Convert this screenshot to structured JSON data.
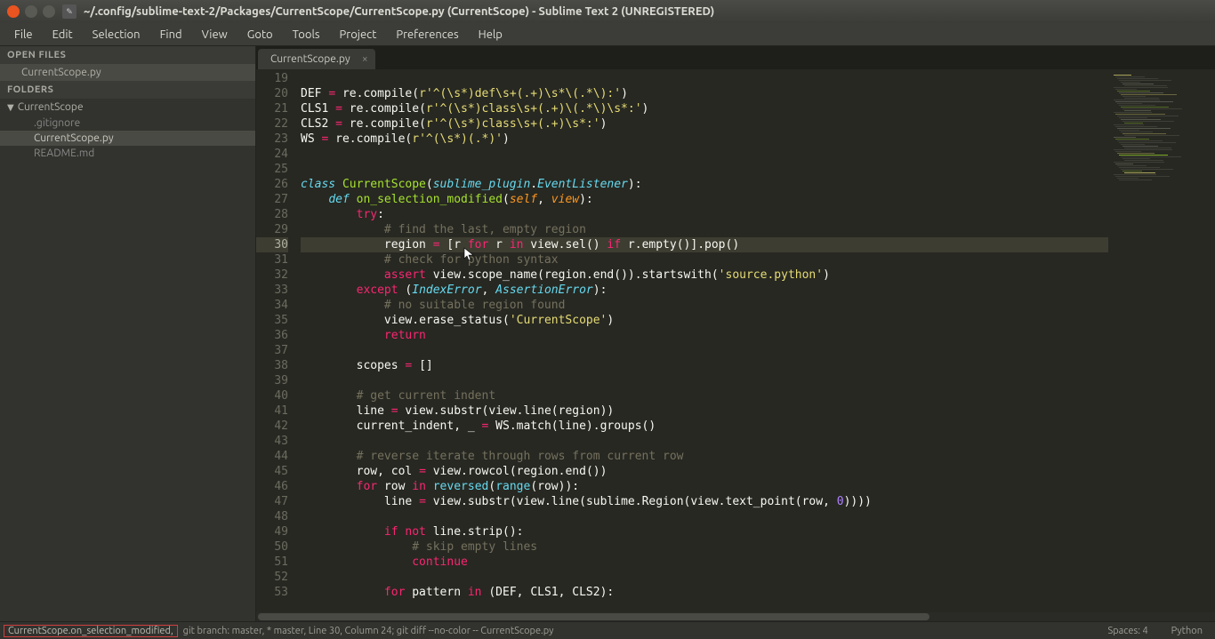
{
  "window": {
    "title": "~/.config/sublime-text-2/Packages/CurrentScope/CurrentScope.py (CurrentScope) - Sublime Text 2 (UNREGISTERED)"
  },
  "menu": [
    "File",
    "Edit",
    "Selection",
    "Find",
    "View",
    "Goto",
    "Tools",
    "Project",
    "Preferences",
    "Help"
  ],
  "open_files_header": "OPEN FILES",
  "open_files": [
    "CurrentScope.py"
  ],
  "folders_header": "FOLDERS",
  "folder_root": "CurrentScope",
  "folder_files": [
    {
      "name": ".gitignore",
      "sel": false
    },
    {
      "name": "CurrentScope.py",
      "sel": true
    },
    {
      "name": "README.md",
      "sel": false
    }
  ],
  "tab_name": "CurrentScope.py",
  "line_start": 19,
  "highlight_line": 30,
  "code_lines": [
    [],
    [
      {
        "c": "var",
        "t": "DEF "
      },
      {
        "c": "op",
        "t": "="
      },
      {
        "c": "var",
        "t": " re"
      },
      {
        "c": "punc",
        "t": "."
      },
      {
        "c": "var",
        "t": "compile"
      },
      {
        "c": "punc",
        "t": "("
      },
      {
        "c": "str",
        "t": "r'^(\\s*)def\\s+(.+)\\s*\\(.*\\):'"
      },
      {
        "c": "punc",
        "t": ")"
      }
    ],
    [
      {
        "c": "var",
        "t": "CLS1 "
      },
      {
        "c": "op",
        "t": "="
      },
      {
        "c": "var",
        "t": " re"
      },
      {
        "c": "punc",
        "t": "."
      },
      {
        "c": "var",
        "t": "compile"
      },
      {
        "c": "punc",
        "t": "("
      },
      {
        "c": "str",
        "t": "r'^(\\s*)class\\s+(.+)\\(.*\\)\\s*:'"
      },
      {
        "c": "punc",
        "t": ")"
      }
    ],
    [
      {
        "c": "var",
        "t": "CLS2 "
      },
      {
        "c": "op",
        "t": "="
      },
      {
        "c": "var",
        "t": " re"
      },
      {
        "c": "punc",
        "t": "."
      },
      {
        "c": "var",
        "t": "compile"
      },
      {
        "c": "punc",
        "t": "("
      },
      {
        "c": "str",
        "t": "r'^(\\s*)class\\s+(.+)\\s*:'"
      },
      {
        "c": "punc",
        "t": ")"
      }
    ],
    [
      {
        "c": "var",
        "t": "WS "
      },
      {
        "c": "op",
        "t": "="
      },
      {
        "c": "var",
        "t": " re"
      },
      {
        "c": "punc",
        "t": "."
      },
      {
        "c": "var",
        "t": "compile"
      },
      {
        "c": "punc",
        "t": "("
      },
      {
        "c": "str",
        "t": "r'^(\\s*)(.*)'"
      },
      {
        "c": "punc",
        "t": ")"
      }
    ],
    [],
    [],
    [
      {
        "c": "def",
        "t": "class "
      },
      {
        "c": "name",
        "t": "CurrentScope"
      },
      {
        "c": "punc",
        "t": "("
      },
      {
        "c": "type",
        "t": "sublime_plugin"
      },
      {
        "c": "punc",
        "t": "."
      },
      {
        "c": "type",
        "t": "EventListener"
      },
      {
        "c": "punc",
        "t": "):"
      }
    ],
    [
      {
        "c": "var",
        "t": "    "
      },
      {
        "c": "def",
        "t": "def "
      },
      {
        "c": "name",
        "t": "on_selection_modified"
      },
      {
        "c": "punc",
        "t": "("
      },
      {
        "c": "param",
        "t": "self"
      },
      {
        "c": "punc",
        "t": ", "
      },
      {
        "c": "param",
        "t": "view"
      },
      {
        "c": "punc",
        "t": "):"
      }
    ],
    [
      {
        "c": "var",
        "t": "        "
      },
      {
        "c": "kw",
        "t": "try"
      },
      {
        "c": "punc",
        "t": ":"
      }
    ],
    [
      {
        "c": "var",
        "t": "            "
      },
      {
        "c": "comment",
        "t": "# find the last, empty region"
      }
    ],
    [
      {
        "c": "var",
        "t": "            region "
      },
      {
        "c": "op",
        "t": "="
      },
      {
        "c": "var",
        "t": " "
      },
      {
        "c": "punc",
        "t": "["
      },
      {
        "c": "var",
        "t": "r "
      },
      {
        "c": "kw",
        "t": "for"
      },
      {
        "c": "var",
        "t": " r "
      },
      {
        "c": "kw",
        "t": "in"
      },
      {
        "c": "var",
        "t": " view"
      },
      {
        "c": "punc",
        "t": "."
      },
      {
        "c": "var",
        "t": "sel"
      },
      {
        "c": "punc",
        "t": "() "
      },
      {
        "c": "kw",
        "t": "if"
      },
      {
        "c": "var",
        "t": " r"
      },
      {
        "c": "punc",
        "t": "."
      },
      {
        "c": "var",
        "t": "empty"
      },
      {
        "c": "punc",
        "t": "()]"
      },
      {
        "c": "punc",
        "t": "."
      },
      {
        "c": "var",
        "t": "pop"
      },
      {
        "c": "punc",
        "t": "()"
      }
    ],
    [
      {
        "c": "var",
        "t": "            "
      },
      {
        "c": "comment",
        "t": "# check for python syntax"
      }
    ],
    [
      {
        "c": "var",
        "t": "            "
      },
      {
        "c": "kw",
        "t": "assert"
      },
      {
        "c": "var",
        "t": " view"
      },
      {
        "c": "punc",
        "t": "."
      },
      {
        "c": "var",
        "t": "scope_name"
      },
      {
        "c": "punc",
        "t": "("
      },
      {
        "c": "var",
        "t": "region"
      },
      {
        "c": "punc",
        "t": "."
      },
      {
        "c": "var",
        "t": "end"
      },
      {
        "c": "punc",
        "t": "())."
      },
      {
        "c": "var",
        "t": "startswith"
      },
      {
        "c": "punc",
        "t": "("
      },
      {
        "c": "str",
        "t": "'source.python'"
      },
      {
        "c": "punc",
        "t": ")"
      }
    ],
    [
      {
        "c": "var",
        "t": "        "
      },
      {
        "c": "kw",
        "t": "except"
      },
      {
        "c": "var",
        "t": " "
      },
      {
        "c": "punc",
        "t": "("
      },
      {
        "c": "type",
        "t": "IndexError"
      },
      {
        "c": "punc",
        "t": ", "
      },
      {
        "c": "type",
        "t": "AssertionError"
      },
      {
        "c": "punc",
        "t": "):"
      }
    ],
    [
      {
        "c": "var",
        "t": "            "
      },
      {
        "c": "comment",
        "t": "# no suitable region found"
      }
    ],
    [
      {
        "c": "var",
        "t": "            view"
      },
      {
        "c": "punc",
        "t": "."
      },
      {
        "c": "var",
        "t": "erase_status"
      },
      {
        "c": "punc",
        "t": "("
      },
      {
        "c": "str",
        "t": "'CurrentScope'"
      },
      {
        "c": "punc",
        "t": ")"
      }
    ],
    [
      {
        "c": "var",
        "t": "            "
      },
      {
        "c": "kw",
        "t": "return"
      }
    ],
    [],
    [
      {
        "c": "var",
        "t": "        scopes "
      },
      {
        "c": "op",
        "t": "="
      },
      {
        "c": "var",
        "t": " "
      },
      {
        "c": "punc",
        "t": "[]"
      }
    ],
    [],
    [
      {
        "c": "var",
        "t": "        "
      },
      {
        "c": "comment",
        "t": "# get current indent"
      }
    ],
    [
      {
        "c": "var",
        "t": "        line "
      },
      {
        "c": "op",
        "t": "="
      },
      {
        "c": "var",
        "t": " view"
      },
      {
        "c": "punc",
        "t": "."
      },
      {
        "c": "var",
        "t": "substr"
      },
      {
        "c": "punc",
        "t": "("
      },
      {
        "c": "var",
        "t": "view"
      },
      {
        "c": "punc",
        "t": "."
      },
      {
        "c": "var",
        "t": "line"
      },
      {
        "c": "punc",
        "t": "("
      },
      {
        "c": "var",
        "t": "region"
      },
      {
        "c": "punc",
        "t": "))"
      }
    ],
    [
      {
        "c": "var",
        "t": "        current_indent"
      },
      {
        "c": "punc",
        "t": ", "
      },
      {
        "c": "var",
        "t": "_ "
      },
      {
        "c": "op",
        "t": "="
      },
      {
        "c": "var",
        "t": " WS"
      },
      {
        "c": "punc",
        "t": "."
      },
      {
        "c": "var",
        "t": "match"
      },
      {
        "c": "punc",
        "t": "("
      },
      {
        "c": "var",
        "t": "line"
      },
      {
        "c": "punc",
        "t": ")."
      },
      {
        "c": "var",
        "t": "groups"
      },
      {
        "c": "punc",
        "t": "()"
      }
    ],
    [],
    [
      {
        "c": "var",
        "t": "        "
      },
      {
        "c": "comment",
        "t": "# reverse iterate through rows from current row"
      }
    ],
    [
      {
        "c": "var",
        "t": "        row"
      },
      {
        "c": "punc",
        "t": ", "
      },
      {
        "c": "var",
        "t": "col "
      },
      {
        "c": "op",
        "t": "="
      },
      {
        "c": "var",
        "t": " view"
      },
      {
        "c": "punc",
        "t": "."
      },
      {
        "c": "var",
        "t": "rowcol"
      },
      {
        "c": "punc",
        "t": "("
      },
      {
        "c": "var",
        "t": "region"
      },
      {
        "c": "punc",
        "t": "."
      },
      {
        "c": "var",
        "t": "end"
      },
      {
        "c": "punc",
        "t": "())"
      }
    ],
    [
      {
        "c": "var",
        "t": "        "
      },
      {
        "c": "kw",
        "t": "for"
      },
      {
        "c": "var",
        "t": " row "
      },
      {
        "c": "kw",
        "t": "in"
      },
      {
        "c": "var",
        "t": " "
      },
      {
        "c": "builtin",
        "t": "reversed"
      },
      {
        "c": "punc",
        "t": "("
      },
      {
        "c": "builtin",
        "t": "range"
      },
      {
        "c": "punc",
        "t": "("
      },
      {
        "c": "var",
        "t": "row"
      },
      {
        "c": "punc",
        "t": ")):"
      }
    ],
    [
      {
        "c": "var",
        "t": "            line "
      },
      {
        "c": "op",
        "t": "="
      },
      {
        "c": "var",
        "t": " view"
      },
      {
        "c": "punc",
        "t": "."
      },
      {
        "c": "var",
        "t": "substr"
      },
      {
        "c": "punc",
        "t": "("
      },
      {
        "c": "var",
        "t": "view"
      },
      {
        "c": "punc",
        "t": "."
      },
      {
        "c": "var",
        "t": "line"
      },
      {
        "c": "punc",
        "t": "("
      },
      {
        "c": "var",
        "t": "sublime"
      },
      {
        "c": "punc",
        "t": "."
      },
      {
        "c": "var",
        "t": "Region"
      },
      {
        "c": "punc",
        "t": "("
      },
      {
        "c": "var",
        "t": "view"
      },
      {
        "c": "punc",
        "t": "."
      },
      {
        "c": "var",
        "t": "text_point"
      },
      {
        "c": "punc",
        "t": "("
      },
      {
        "c": "var",
        "t": "row"
      },
      {
        "c": "punc",
        "t": ", "
      },
      {
        "c": "num",
        "t": "0"
      },
      {
        "c": "punc",
        "t": "))))"
      }
    ],
    [],
    [
      {
        "c": "var",
        "t": "            "
      },
      {
        "c": "kw",
        "t": "if"
      },
      {
        "c": "var",
        "t": " "
      },
      {
        "c": "kw",
        "t": "not"
      },
      {
        "c": "var",
        "t": " line"
      },
      {
        "c": "punc",
        "t": "."
      },
      {
        "c": "var",
        "t": "strip"
      },
      {
        "c": "punc",
        "t": "():"
      }
    ],
    [
      {
        "c": "var",
        "t": "                "
      },
      {
        "c": "comment",
        "t": "# skip empty lines"
      }
    ],
    [
      {
        "c": "var",
        "t": "                "
      },
      {
        "c": "kw",
        "t": "continue"
      }
    ],
    [],
    [
      {
        "c": "var",
        "t": "            "
      },
      {
        "c": "kw",
        "t": "for"
      },
      {
        "c": "var",
        "t": " pattern "
      },
      {
        "c": "kw",
        "t": "in"
      },
      {
        "c": "var",
        "t": " "
      },
      {
        "c": "punc",
        "t": "("
      },
      {
        "c": "var",
        "t": "DEF"
      },
      {
        "c": "punc",
        "t": ", "
      },
      {
        "c": "var",
        "t": "CLS1"
      },
      {
        "c": "punc",
        "t": ", "
      },
      {
        "c": "var",
        "t": "CLS2"
      },
      {
        "c": "punc",
        "t": "):"
      }
    ]
  ],
  "status": {
    "scope": "CurrentScope.on_selection_modified,",
    "git": "git branch: master, * master, Line 30, Column 24; git diff --no-color -- CurrentScope.py",
    "spaces": "Spaces: 4",
    "syntax": "Python"
  }
}
